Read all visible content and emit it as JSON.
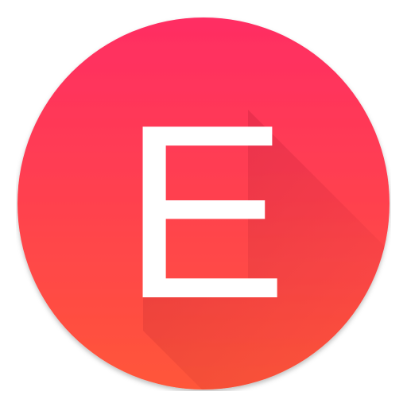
{
  "icon": {
    "letter": "E",
    "name": "app-launcher-icon",
    "colors": {
      "gradient_top": "#ff2d63",
      "gradient_bottom": "#ff5639",
      "letter": "#ffffff",
      "long_shadow": "#8a0a1e"
    }
  }
}
